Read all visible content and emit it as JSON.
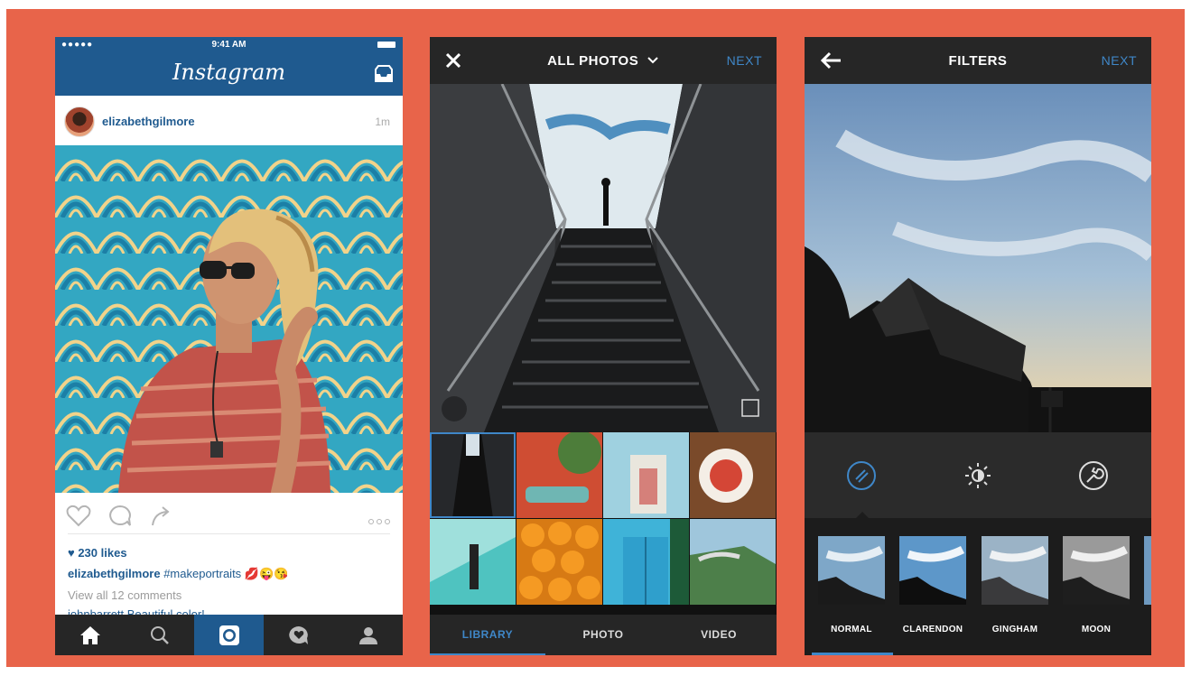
{
  "colors": {
    "background": "#e8644a",
    "brand_blue": "#1f5a8f",
    "accent_blue": "#3f87c8",
    "dark_bar": "#262626"
  },
  "feed": {
    "status": {
      "signal": "●●●●● ",
      "time": "9:41 AM"
    },
    "app_title": "Instagram",
    "post": {
      "username": "elizabethgilmore",
      "time": "1m",
      "likes": "♥ 230 likes",
      "caption_user": "elizabethgilmore",
      "caption_text": "#makeportraits",
      "caption_emoji": "💋😜😘",
      "view_comments": "View all 12 comments",
      "comment_preview": "johnbarrett Beautiful color!"
    },
    "tabs": [
      "home-icon",
      "search-icon",
      "camera-icon",
      "activity-icon",
      "profile-icon"
    ]
  },
  "library": {
    "title": "ALL PHOTOS",
    "next": "NEXT",
    "tabs": [
      {
        "label": "LIBRARY",
        "active": true
      },
      {
        "label": "PHOTO",
        "active": false
      },
      {
        "label": "VIDEO",
        "active": false
      }
    ]
  },
  "filters": {
    "title": "FILTERS",
    "next": "NEXT",
    "tools": [
      "filter-wand-icon",
      "brightness-icon",
      "edit-wrench-icon"
    ],
    "items": [
      {
        "label": "NORMAL",
        "selected": true
      },
      {
        "label": "CLARENDON",
        "selected": false
      },
      {
        "label": "GINGHAM",
        "selected": false
      },
      {
        "label": "MOON",
        "selected": false
      }
    ]
  }
}
